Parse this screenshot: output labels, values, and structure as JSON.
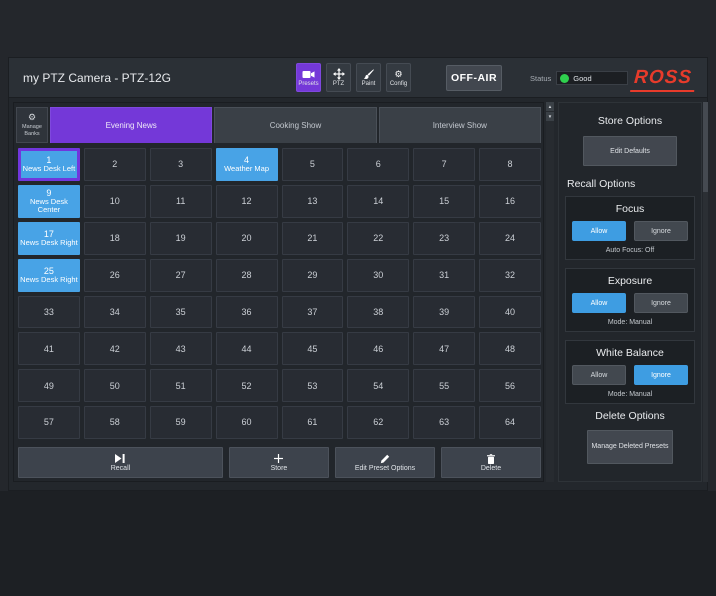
{
  "header": {
    "title": "my PTZ Camera - PTZ-12G",
    "nav": [
      {
        "label": "Presets",
        "icon": "camera-icon",
        "active": true
      },
      {
        "label": "PTZ",
        "icon": "ptz-move-icon",
        "active": false
      },
      {
        "label": "Paint",
        "icon": "paint-brush-icon",
        "active": false
      },
      {
        "label": "Config",
        "icon": "config-gear-icon",
        "active": false
      }
    ],
    "off_air_label": "OFF-AIR",
    "status_label": "Status",
    "status_value": "Good",
    "brand": "ROSS"
  },
  "banks": {
    "manage_label": "Manage Banks",
    "tabs": [
      {
        "label": "Evening News",
        "active": true
      },
      {
        "label": "Cooking Show",
        "active": false
      },
      {
        "label": "Interview Show",
        "active": false
      }
    ]
  },
  "presets": {
    "cells": [
      {
        "num": "1",
        "name": "News Desk Left",
        "stored": true,
        "selected": true
      },
      {
        "num": "2"
      },
      {
        "num": "3"
      },
      {
        "num": "4",
        "name": "Weather Map",
        "stored": true
      },
      {
        "num": "5"
      },
      {
        "num": "6"
      },
      {
        "num": "7"
      },
      {
        "num": "8"
      },
      {
        "num": "9",
        "name": "News Desk Center",
        "stored": true
      },
      {
        "num": "10"
      },
      {
        "num": "11"
      },
      {
        "num": "12"
      },
      {
        "num": "13"
      },
      {
        "num": "14"
      },
      {
        "num": "15"
      },
      {
        "num": "16"
      },
      {
        "num": "17",
        "name": "News Desk Right",
        "stored": true
      },
      {
        "num": "18"
      },
      {
        "num": "19"
      },
      {
        "num": "20"
      },
      {
        "num": "21"
      },
      {
        "num": "22"
      },
      {
        "num": "23"
      },
      {
        "num": "24"
      },
      {
        "num": "25",
        "name": "News Desk Right",
        "stored": true
      },
      {
        "num": "26"
      },
      {
        "num": "27"
      },
      {
        "num": "28"
      },
      {
        "num": "29"
      },
      {
        "num": "30"
      },
      {
        "num": "31"
      },
      {
        "num": "32"
      },
      {
        "num": "33"
      },
      {
        "num": "34"
      },
      {
        "num": "35"
      },
      {
        "num": "36"
      },
      {
        "num": "37"
      },
      {
        "num": "38"
      },
      {
        "num": "39"
      },
      {
        "num": "40"
      },
      {
        "num": "41"
      },
      {
        "num": "42"
      },
      {
        "num": "43"
      },
      {
        "num": "44"
      },
      {
        "num": "45"
      },
      {
        "num": "46"
      },
      {
        "num": "47"
      },
      {
        "num": "48"
      },
      {
        "num": "49"
      },
      {
        "num": "50"
      },
      {
        "num": "51"
      },
      {
        "num": "52"
      },
      {
        "num": "53"
      },
      {
        "num": "54"
      },
      {
        "num": "55"
      },
      {
        "num": "56"
      },
      {
        "num": "57"
      },
      {
        "num": "58"
      },
      {
        "num": "59"
      },
      {
        "num": "60"
      },
      {
        "num": "61"
      },
      {
        "num": "62"
      },
      {
        "num": "63"
      },
      {
        "num": "64"
      }
    ]
  },
  "actions": [
    {
      "label": "Recall",
      "icon": "recall-icon",
      "wide": true
    },
    {
      "label": "Store",
      "icon": "store-plus-icon",
      "wide": false
    },
    {
      "label": "Edit Preset Options",
      "icon": "edit-pencil-icon",
      "wide": false
    },
    {
      "label": "Delete",
      "icon": "delete-trash-icon",
      "wide": false
    }
  ],
  "sidebar": {
    "store_options": {
      "heading": "Store Options",
      "edit_defaults_label": "Edit Defaults"
    },
    "recall_options": {
      "heading": "Recall Options",
      "panels": [
        {
          "title": "Focus",
          "allow_label": "Allow",
          "ignore_label": "Ignore",
          "selected": "allow",
          "info": "Auto Focus: Off"
        },
        {
          "title": "Exposure",
          "allow_label": "Allow",
          "ignore_label": "Ignore",
          "selected": "allow",
          "info": "Mode: Manual"
        },
        {
          "title": "White Balance",
          "allow_label": "Allow",
          "ignore_label": "Ignore",
          "selected": "ignore",
          "info": "Mode: Manual"
        }
      ]
    },
    "delete_options": {
      "heading": "Delete Options",
      "manage_label": "Manage Deleted Presets"
    }
  },
  "icons": {
    "gear_glyph": "⚙",
    "scroll_up_glyph": "▲",
    "scroll_down_glyph": "▼"
  },
  "colors": {
    "accent_purple": "#7438d8",
    "preset_blue": "#48a3e6",
    "allow_blue": "#3e9de2",
    "status_green": "#2fd04e",
    "brand_red": "#e73b2b"
  }
}
